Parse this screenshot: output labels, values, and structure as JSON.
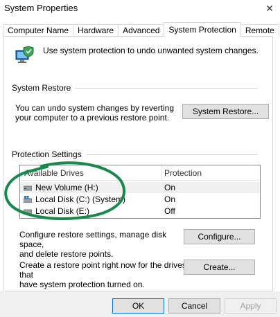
{
  "window": {
    "title": "System Properties",
    "close_glyph": "✕"
  },
  "tabs": [
    {
      "label": "Computer Name"
    },
    {
      "label": "Hardware"
    },
    {
      "label": "Advanced"
    },
    {
      "label": "System Protection"
    },
    {
      "label": "Remote"
    }
  ],
  "active_tab": "System Protection",
  "intro": {
    "icon": "computer-shield-icon",
    "text": "Use system protection to undo unwanted system changes."
  },
  "system_restore": {
    "group_title": "System Restore",
    "description_line1": "You can undo system changes by reverting",
    "description_line2": "your computer to a previous restore point.",
    "button_label": "System Restore..."
  },
  "protection_settings": {
    "group_title": "Protection Settings",
    "columns": [
      "Available Drives",
      "Protection"
    ],
    "drives": [
      {
        "name": "New Volume (H:)",
        "protection": "On",
        "icon": "drive-icon",
        "selected": true
      },
      {
        "name": "Local Disk (C:) (System)",
        "protection": "On",
        "icon": "windows-drive-icon",
        "selected": false
      },
      {
        "name": "Local Disk (E:)",
        "protection": "Off",
        "icon": "drive-icon",
        "selected": false
      }
    ],
    "configure_text_line1": "Configure restore settings, manage disk space,",
    "configure_text_line2": "and delete restore points.",
    "configure_button": "Configure...",
    "create_text_line1": "Create a restore point right now for the drives that",
    "create_text_line2": "have system protection turned on.",
    "create_button": "Create..."
  },
  "footer": {
    "ok": "OK",
    "cancel": "Cancel",
    "apply": "Apply"
  },
  "colors": {
    "annotation_green": "#17894a",
    "focus_blue": "#0078d7"
  }
}
